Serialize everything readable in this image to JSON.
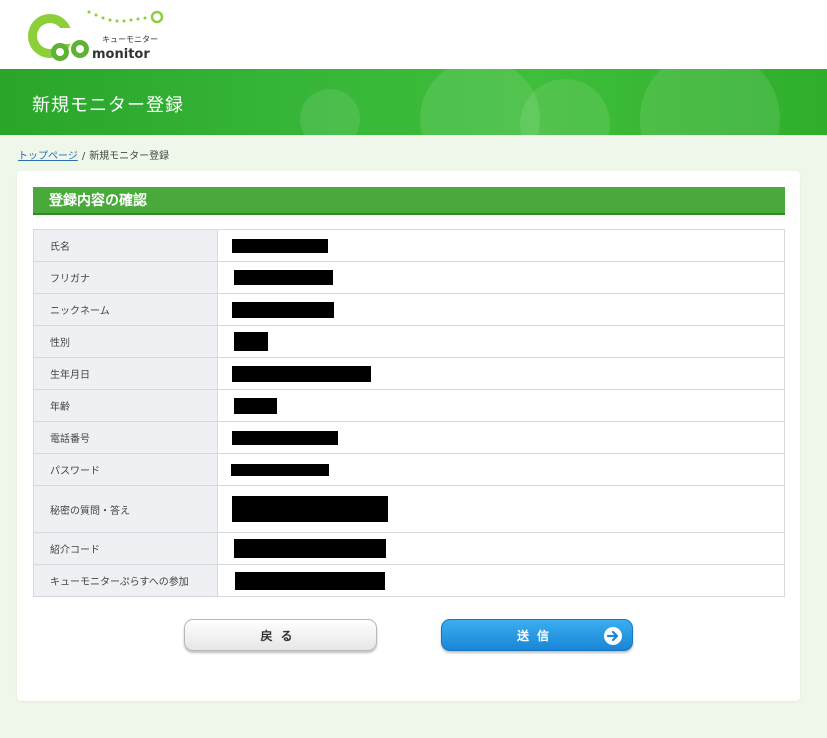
{
  "header": {
    "logo_text": "Cue",
    "logo_sub": "monitor",
    "logo_kana": "キューモニター",
    "banner_title": "新規モニター登録"
  },
  "breadcrumb": {
    "home_label": "トップページ",
    "separator": "/",
    "current_label": "新規モニター登録"
  },
  "section": {
    "title": "登録内容の確認"
  },
  "fields": [
    {
      "label": "氏名"
    },
    {
      "label": "フリガナ"
    },
    {
      "label": "ニックネーム"
    },
    {
      "label": "性別"
    },
    {
      "label": "生年月日"
    },
    {
      "label": "年齢"
    },
    {
      "label": "電話番号"
    },
    {
      "label": "パスワード"
    },
    {
      "label": "秘密の質問・答え"
    },
    {
      "label": "紹介コード"
    },
    {
      "label": "キューモニターぷらすへの参加"
    }
  ],
  "buttons": {
    "back_label": "戻る",
    "send_label": "送信"
  },
  "colors": {
    "brand_green": "#3fb93a",
    "accent_blue": "#1f8fe0"
  }
}
